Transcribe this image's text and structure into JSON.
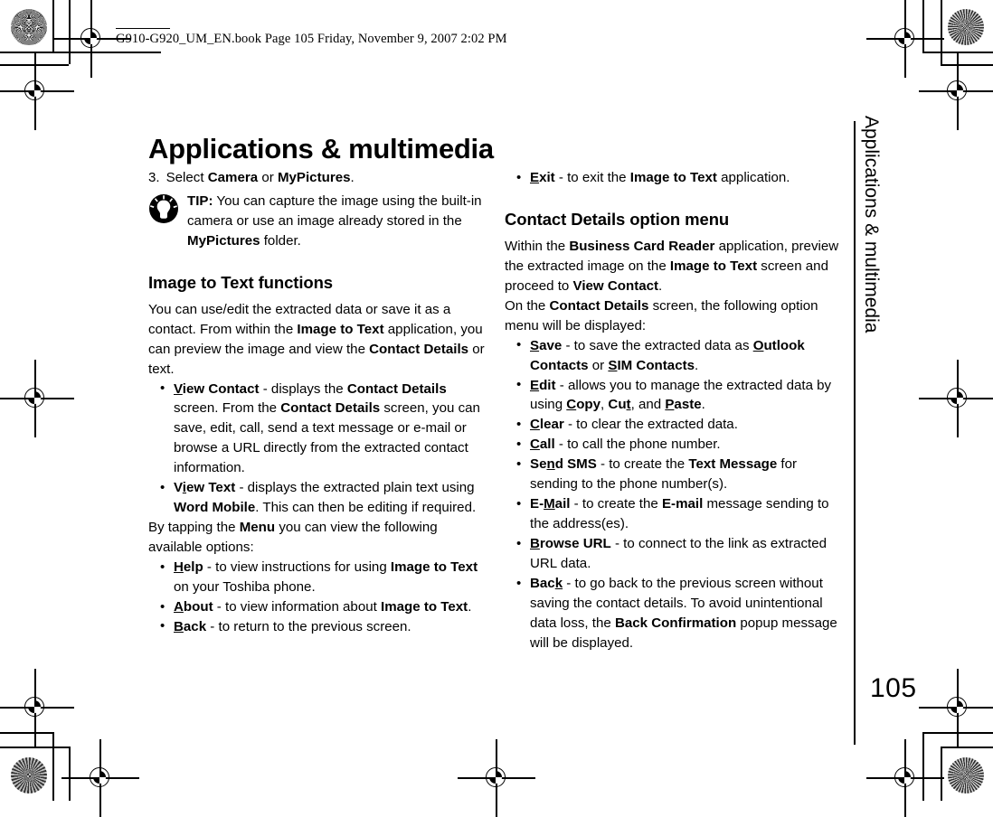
{
  "book_header": "G910-G920_UM_EN.book  Page 105  Friday, November 9, 2007  2:02 PM",
  "page_title": "Applications & multimedia",
  "edge_tab": "Applications & multimedia",
  "page_number": "105",
  "icons": {
    "tip": "lightbulb-icon",
    "registration": "registration-crosshair-icon",
    "rosette": "color-rosette-icon"
  },
  "left_column": {
    "step": {
      "number": "3.",
      "text_parts": [
        {
          "t": "Select ",
          "b": false
        },
        {
          "t": "Camera",
          "b": true
        },
        {
          "t": " or ",
          "b": false
        },
        {
          "t": "MyPictures",
          "b": true
        },
        {
          "t": ".",
          "b": false
        }
      ]
    },
    "tip": {
      "label": "TIP:",
      "body_parts": [
        {
          "t": " You can capture the image using the built-in camera or use an image already stored in the ",
          "b": false
        },
        {
          "t": "MyPictures",
          "b": true
        },
        {
          "t": " folder.",
          "b": false
        }
      ]
    },
    "section_heading": "Image to Text functions",
    "intro_parts": [
      {
        "t": "You can use/edit the extracted data or save it as a contact. From within the ",
        "b": false
      },
      {
        "t": "Image to Text",
        "b": true
      },
      {
        "t": " application, you can preview the image and view the ",
        "b": false
      },
      {
        "t": "Contact Details",
        "b": true
      },
      {
        "t": " or text.",
        "b": false
      }
    ],
    "bullets_1": [
      {
        "name": "view-contact",
        "parts": [
          {
            "t": "V",
            "b": true,
            "u": true
          },
          {
            "t": "iew Contact",
            "b": true
          },
          {
            "t": " - displays the ",
            "b": false
          },
          {
            "t": "Contact Details",
            "b": true
          },
          {
            "t": " screen. From the ",
            "b": false
          },
          {
            "t": "Contact Details",
            "b": true
          },
          {
            "t": " screen, you can save, edit, call, send a text message or e-mail or browse a URL directly from the extracted contact information.",
            "b": false
          }
        ]
      },
      {
        "name": "view-text",
        "parts": [
          {
            "t": "V",
            "b": true
          },
          {
            "t": "i",
            "b": true,
            "u": true
          },
          {
            "t": "ew Text",
            "b": true
          },
          {
            "t": " - displays the extracted plain text using ",
            "b": false
          },
          {
            "t": "Word Mobile",
            "b": true
          },
          {
            "t": ". This can then be editing if required.",
            "b": false
          }
        ]
      }
    ],
    "menu_intro_parts": [
      {
        "t": "By tapping the ",
        "b": false
      },
      {
        "t": "Menu",
        "b": true
      },
      {
        "t": " you can view the following available options:",
        "b": false
      }
    ],
    "bullets_2": [
      {
        "name": "help",
        "parts": [
          {
            "t": "H",
            "b": true,
            "u": true
          },
          {
            "t": "elp",
            "b": true
          },
          {
            "t": " - to view instructions for using ",
            "b": false
          },
          {
            "t": "Image to Text",
            "b": true
          },
          {
            "t": " on your Toshiba phone.",
            "b": false
          }
        ]
      },
      {
        "name": "about",
        "parts": [
          {
            "t": "A",
            "b": true,
            "u": true
          },
          {
            "t": "bout",
            "b": true
          },
          {
            "t": " - to view information about ",
            "b": false
          },
          {
            "t": "Image to Text",
            "b": true
          },
          {
            "t": ".",
            "b": false
          }
        ]
      },
      {
        "name": "back",
        "parts": [
          {
            "t": "B",
            "b": true,
            "u": true
          },
          {
            "t": "ack",
            "b": true
          },
          {
            "t": " - to return to the previous screen.",
            "b": false
          }
        ]
      }
    ]
  },
  "right_column": {
    "bullets_0": [
      {
        "name": "exit",
        "parts": [
          {
            "t": "E",
            "b": true,
            "u": true
          },
          {
            "t": "xit",
            "b": true
          },
          {
            "t": " - to exit the ",
            "b": false
          },
          {
            "t": "Image to Text",
            "b": true
          },
          {
            "t": " application.",
            "b": false
          }
        ]
      }
    ],
    "section_heading": "Contact Details option menu",
    "intro_parts": [
      {
        "t": "Within the ",
        "b": false
      },
      {
        "t": "Business Card Reader",
        "b": true
      },
      {
        "t": " application, preview the extracted image on the ",
        "b": false
      },
      {
        "t": "Image to Text",
        "b": true
      },
      {
        "t": " screen and proceed to ",
        "b": false
      },
      {
        "t": "View Contact",
        "b": true
      },
      {
        "t": ".",
        "b": false
      }
    ],
    "intro2_parts": [
      {
        "t": "On the ",
        "b": false
      },
      {
        "t": "Contact Details",
        "b": true
      },
      {
        "t": " screen, the following option menu will be displayed:",
        "b": false
      }
    ],
    "bullets_1": [
      {
        "name": "save",
        "parts": [
          {
            "t": "S",
            "b": true,
            "u": true
          },
          {
            "t": "ave",
            "b": true
          },
          {
            "t": " - to save the extracted data as ",
            "b": false
          },
          {
            "t": "O",
            "b": true,
            "u": true
          },
          {
            "t": "utlook Contacts",
            "b": true
          },
          {
            "t": " or ",
            "b": false
          },
          {
            "t": "S",
            "b": true,
            "u": true
          },
          {
            "t": "IM Contacts",
            "b": true
          },
          {
            "t": ".",
            "b": false
          }
        ]
      },
      {
        "name": "edit",
        "parts": [
          {
            "t": "E",
            "b": true,
            "u": true
          },
          {
            "t": "dit",
            "b": true
          },
          {
            "t": " - allows you to manage the extracted data by using ",
            "b": false
          },
          {
            "t": "C",
            "b": true,
            "u": true
          },
          {
            "t": "opy",
            "b": true
          },
          {
            "t": ", ",
            "b": false
          },
          {
            "t": "Cu",
            "b": true
          },
          {
            "t": "t",
            "b": true,
            "u": true
          },
          {
            "t": ", and ",
            "b": false
          },
          {
            "t": "P",
            "b": true,
            "u": true
          },
          {
            "t": "aste",
            "b": true
          },
          {
            "t": ".",
            "b": false
          }
        ]
      },
      {
        "name": "clear",
        "parts": [
          {
            "t": "C",
            "b": true,
            "u": true
          },
          {
            "t": "lear",
            "b": true
          },
          {
            "t": " - to clear the extracted data.",
            "b": false
          }
        ]
      },
      {
        "name": "call",
        "parts": [
          {
            "t": "C",
            "b": true,
            "u": true
          },
          {
            "t": "all",
            "b": true
          },
          {
            "t": " - to call the phone number.",
            "b": false
          }
        ]
      },
      {
        "name": "send-sms",
        "parts": [
          {
            "t": "Se",
            "b": true
          },
          {
            "t": "n",
            "b": true,
            "u": true
          },
          {
            "t": "d SMS",
            "b": true
          },
          {
            "t": " - to create the ",
            "b": false
          },
          {
            "t": "Text Message",
            "b": true
          },
          {
            "t": " for sending to the phone number(s).",
            "b": false
          }
        ]
      },
      {
        "name": "e-mail",
        "parts": [
          {
            "t": "E-",
            "b": true
          },
          {
            "t": "M",
            "b": true,
            "u": true
          },
          {
            "t": "ail",
            "b": true
          },
          {
            "t": " - to create the ",
            "b": false
          },
          {
            "t": "E-mail",
            "b": true
          },
          {
            "t": " message sending to the address(es).",
            "b": false
          }
        ]
      },
      {
        "name": "browse-url",
        "parts": [
          {
            "t": "B",
            "b": true,
            "u": true
          },
          {
            "t": "rowse URL",
            "b": true
          },
          {
            "t": " - to connect to the link as extracted URL data.",
            "b": false
          }
        ]
      },
      {
        "name": "back",
        "parts": [
          {
            "t": "Bac",
            "b": true
          },
          {
            "t": "k",
            "b": true,
            "u": true
          },
          {
            "t": " - to go back to the previous screen without saving the contact details. To avoid unintentional data loss, the ",
            "b": false
          },
          {
            "t": "Back Confirmation",
            "b": true
          },
          {
            "t": " popup message will be displayed.",
            "b": false
          }
        ]
      }
    ]
  }
}
